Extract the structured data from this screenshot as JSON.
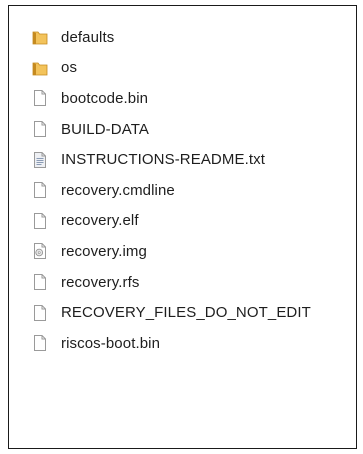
{
  "files": [
    {
      "name": "defaults",
      "icon": "folder-icon"
    },
    {
      "name": "os",
      "icon": "folder-icon"
    },
    {
      "name": "bootcode.bin",
      "icon": "file-icon"
    },
    {
      "name": "BUILD-DATA",
      "icon": "file-icon"
    },
    {
      "name": "INSTRUCTIONS-README.txt",
      "icon": "text-file-icon"
    },
    {
      "name": "recovery.cmdline",
      "icon": "file-icon"
    },
    {
      "name": "recovery.elf",
      "icon": "file-icon"
    },
    {
      "name": "recovery.img",
      "icon": "disc-image-file-icon"
    },
    {
      "name": "recovery.rfs",
      "icon": "file-icon"
    },
    {
      "name": "RECOVERY_FILES_DO_NOT_EDIT",
      "icon": "file-icon"
    },
    {
      "name": "riscos-boot.bin",
      "icon": "file-icon"
    }
  ],
  "colors": {
    "folder": "#e8b04a",
    "folder_dark": "#c58a1f",
    "file_border": "#9a9a9a",
    "text": "#1e1e1e"
  }
}
